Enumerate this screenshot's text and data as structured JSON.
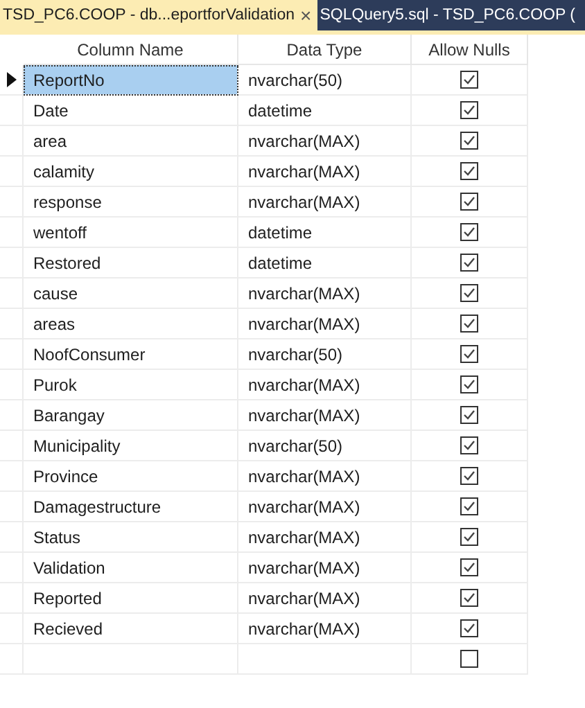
{
  "tabs": [
    {
      "label": "TSD_PC6.COOP - db...eportforValidation",
      "selected": true,
      "close": "×"
    },
    {
      "label": "SQLQuery5.sql - TSD_PC6.COOP (",
      "selected": false
    }
  ],
  "table": {
    "columns": [
      "Column Name",
      "Data Type",
      "Allow Nulls"
    ],
    "rows": [
      {
        "name": "ReportNo",
        "type": "nvarchar(50)",
        "allow_nulls": true,
        "selected": true
      },
      {
        "name": "Date",
        "type": "datetime",
        "allow_nulls": true,
        "selected": false
      },
      {
        "name": "area",
        "type": "nvarchar(MAX)",
        "allow_nulls": true,
        "selected": false
      },
      {
        "name": "calamity",
        "type": "nvarchar(MAX)",
        "allow_nulls": true,
        "selected": false
      },
      {
        "name": "response",
        "type": "nvarchar(MAX)",
        "allow_nulls": true,
        "selected": false
      },
      {
        "name": "wentoff",
        "type": "datetime",
        "allow_nulls": true,
        "selected": false
      },
      {
        "name": "Restored",
        "type": "datetime",
        "allow_nulls": true,
        "selected": false
      },
      {
        "name": "cause",
        "type": "nvarchar(MAX)",
        "allow_nulls": true,
        "selected": false
      },
      {
        "name": "areas",
        "type": "nvarchar(MAX)",
        "allow_nulls": true,
        "selected": false
      },
      {
        "name": "NoofConsumer",
        "type": "nvarchar(50)",
        "allow_nulls": true,
        "selected": false
      },
      {
        "name": "Purok",
        "type": "nvarchar(MAX)",
        "allow_nulls": true,
        "selected": false
      },
      {
        "name": "Barangay",
        "type": "nvarchar(MAX)",
        "allow_nulls": true,
        "selected": false
      },
      {
        "name": "Municipality",
        "type": "nvarchar(50)",
        "allow_nulls": true,
        "selected": false
      },
      {
        "name": "Province",
        "type": "nvarchar(MAX)",
        "allow_nulls": true,
        "selected": false
      },
      {
        "name": "Damagestructure",
        "type": "nvarchar(MAX)",
        "allow_nulls": true,
        "selected": false
      },
      {
        "name": "Status",
        "type": "nvarchar(MAX)",
        "allow_nulls": true,
        "selected": false
      },
      {
        "name": "Validation",
        "type": "nvarchar(MAX)",
        "allow_nulls": true,
        "selected": false
      },
      {
        "name": "Reported",
        "type": "nvarchar(MAX)",
        "allow_nulls": true,
        "selected": false
      },
      {
        "name": "Recieved",
        "type": "nvarchar(MAX)",
        "allow_nulls": true,
        "selected": false
      }
    ],
    "new_row": {
      "allow_nulls": false
    }
  }
}
